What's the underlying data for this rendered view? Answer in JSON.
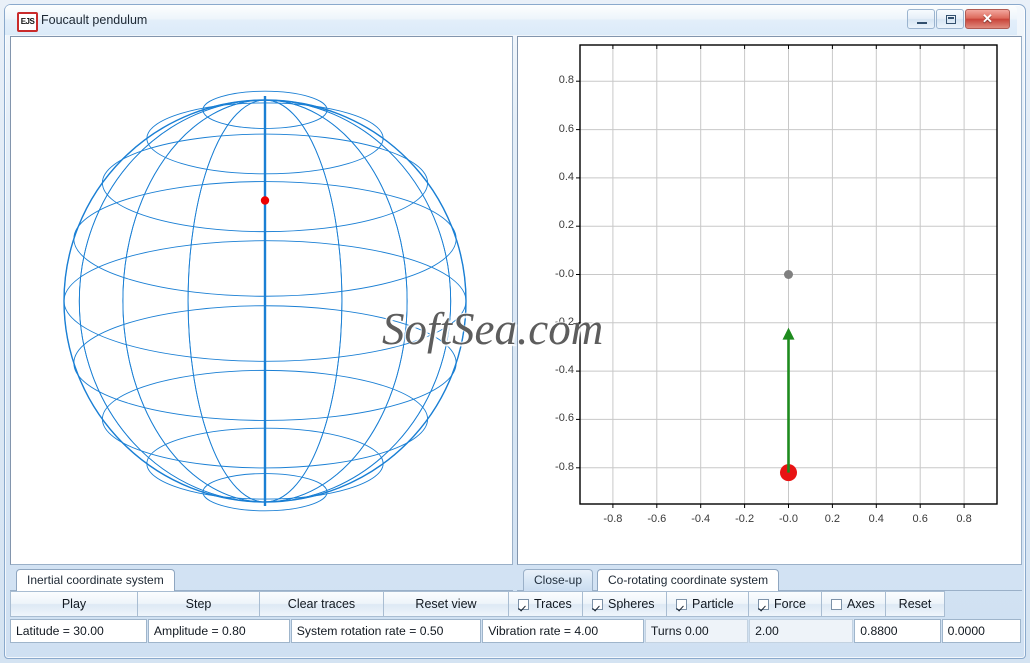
{
  "window": {
    "title": "Foucault pendulum",
    "icon_label": "EJS",
    "icon_name": "ejs-icon",
    "buttons": {
      "minimize": "minimize-icon",
      "maximize": "maximize-icon",
      "close": "✕"
    }
  },
  "watermark": "SoftSea.com",
  "left_panel": {
    "tabs": [
      {
        "label": "Inertial coordinate system",
        "selected": true
      }
    ],
    "view": {
      "type": "wireframe-sphere",
      "sphere_color": "#1a7fd4",
      "axis_color": "#1a7fd4",
      "particle_color": "#ee0000",
      "latitude_deg": 30.0,
      "meridians": 16,
      "parallels": 9
    }
  },
  "right_panel": {
    "tabs": [
      {
        "label": "Close-up",
        "selected": false
      },
      {
        "label": "Co-rotating coordinate system",
        "selected": true
      }
    ]
  },
  "chart_data": {
    "type": "scatter",
    "title": "",
    "xlabel": "",
    "ylabel": "",
    "xlim": [
      -0.95,
      0.95
    ],
    "ylim": [
      -0.95,
      0.95
    ],
    "grid": true,
    "legend": false,
    "xticks": [
      -0.8,
      -0.6,
      -0.4,
      -0.2,
      -0.0,
      0.2,
      0.4,
      0.6,
      0.8
    ],
    "xticklabels": [
      "-0.8",
      "-0.6",
      "-0.4",
      "-0.2",
      "-0.0",
      "0.2",
      "0.4",
      "0.6",
      "0.8"
    ],
    "yticks": [
      0.8,
      0.6,
      0.4,
      0.2,
      -0.0,
      -0.2,
      -0.4,
      -0.6,
      -0.8
    ],
    "yticklabels": [
      "0.8",
      "0.6",
      "0.4",
      "0.2",
      "-0.0",
      "-0.2",
      "-0.4",
      "-0.6",
      "-0.8"
    ],
    "series": [
      {
        "name": "pivot",
        "type": "scatter",
        "marker": "circle",
        "color": "#808080",
        "size": 9,
        "x": [
          0.0
        ],
        "y": [
          0.0
        ]
      },
      {
        "name": "particle",
        "type": "scatter",
        "marker": "circle",
        "color": "#e81414",
        "size": 17,
        "x": [
          0.0
        ],
        "y": [
          -0.82
        ]
      },
      {
        "name": "force",
        "type": "arrow",
        "color": "#1e8b1e",
        "x": [
          0.0,
          0.0
        ],
        "y": [
          -0.82,
          -0.22
        ]
      }
    ],
    "annotations": [
      "SoftSea.com"
    ]
  },
  "toolbar": {
    "buttons": [
      {
        "label": "Play",
        "width": 128
      },
      {
        "label": "Step",
        "width": 123
      },
      {
        "label": "Clear traces",
        "width": 125
      },
      {
        "label": "Reset view",
        "width": 126
      }
    ],
    "checkboxes": [
      {
        "label": "Traces",
        "checked": true,
        "width": 75
      },
      {
        "label": "Spheres",
        "checked": true,
        "width": 85
      },
      {
        "label": "Particle",
        "checked": true,
        "width": 83
      },
      {
        "label": "Force",
        "checked": true,
        "width": 74
      },
      {
        "label": "Axes",
        "checked": false,
        "width": 65
      }
    ],
    "reset_button": {
      "label": "Reset",
      "width": 60
    }
  },
  "status_fields": [
    {
      "value": "Latitude = 30.00",
      "width": 138,
      "flat": false
    },
    {
      "value": "Amplitude = 0.80",
      "width": 143,
      "flat": false
    },
    {
      "value": "System rotation rate = 0.50",
      "width": 192,
      "flat": false
    },
    {
      "value": "Vibration rate = 4.00",
      "width": 163,
      "flat": false
    },
    {
      "value": "Turns 0.00",
      "width": 104,
      "flat": true
    },
    {
      "value": "2.00",
      "width": 105,
      "flat": true
    },
    {
      "value": "0.8800",
      "width": 87,
      "flat": false
    },
    {
      "value": "0.0000",
      "width": 80,
      "flat": false
    }
  ]
}
